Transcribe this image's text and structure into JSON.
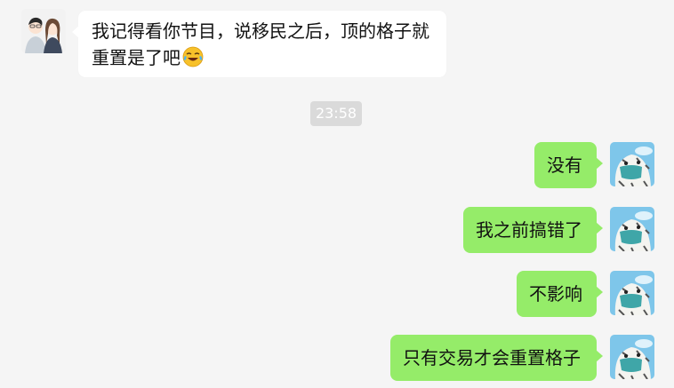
{
  "incoming": {
    "line1": "我记得看你节目，说移民之后，顶的格子就",
    "line2": "重置是了吧",
    "emoji": "laughing-crying-emoji"
  },
  "timestamp": "23:58",
  "outgoing": [
    {
      "text": "没有"
    },
    {
      "text": "我之前搞错了"
    },
    {
      "text": "不影响"
    },
    {
      "text": "只有交易才会重置格子"
    }
  ],
  "colors": {
    "background": "#f5f5f5",
    "incoming_bubble": "#ffffff",
    "outgoing_bubble": "#95ec69",
    "timestamp_bg": "#dadada"
  }
}
